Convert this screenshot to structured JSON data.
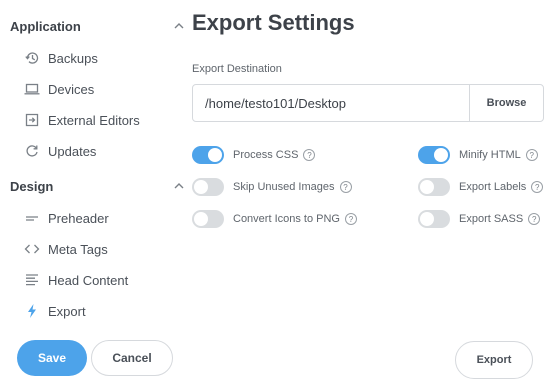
{
  "sidebar": {
    "sections": [
      {
        "title": "Application",
        "items": [
          {
            "label": "Backups",
            "icon": "history-icon"
          },
          {
            "label": "Devices",
            "icon": "laptop-icon"
          },
          {
            "label": "External Editors",
            "icon": "external-editor-icon"
          },
          {
            "label": "Updates",
            "icon": "refresh-icon"
          }
        ]
      },
      {
        "title": "Design",
        "items": [
          {
            "label": "Preheader",
            "icon": "preheader-icon"
          },
          {
            "label": "Meta Tags",
            "icon": "code-icon"
          },
          {
            "label": "Head Content",
            "icon": "text-lines-icon"
          },
          {
            "label": "Export",
            "icon": "lightning-icon"
          }
        ]
      }
    ],
    "save_label": "Save",
    "cancel_label": "Cancel"
  },
  "main": {
    "title": "Export Settings",
    "destination_label": "Export Destination",
    "destination_value": "/home/testo101/Desktop",
    "browse_label": "Browse",
    "options": [
      {
        "label": "Process CSS",
        "on": true
      },
      {
        "label": "Minify HTML",
        "on": true
      },
      {
        "label": "Skip Unused Images",
        "on": false
      },
      {
        "label": "Export Labels",
        "on": false
      },
      {
        "label": "Convert Icons to PNG",
        "on": false
      },
      {
        "label": "Export SASS",
        "on": false
      }
    ],
    "export_label": "Export"
  },
  "colors": {
    "accent": "#4da3ea",
    "toggle_off": "#d9dcdf",
    "text": "#4a5058"
  }
}
